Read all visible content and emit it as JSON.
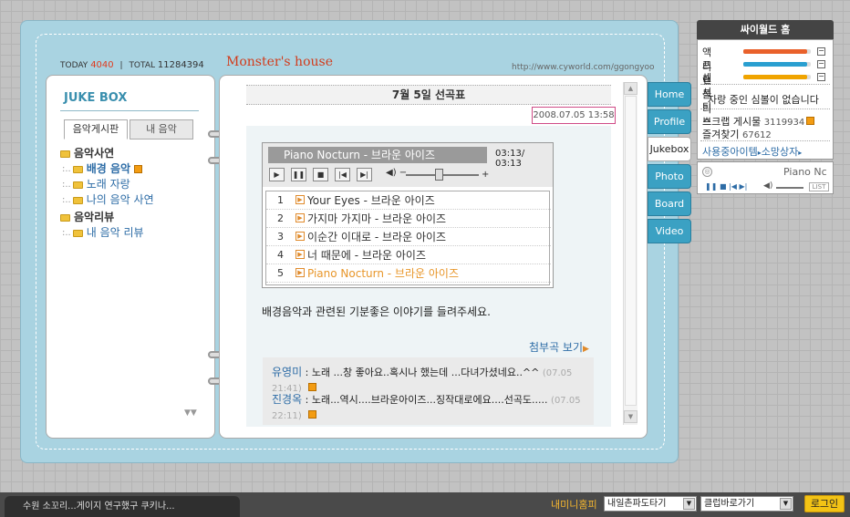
{
  "header": {
    "today_label": "TODAY",
    "today_count": "4040",
    "total_label": "TOTAL",
    "total_count": "11284394",
    "site_title": "Monster's house",
    "url": "http://www.cyworld.com/ggongyoo"
  },
  "left": {
    "title": "JUKE BOX",
    "tabs": [
      "음악게시판",
      "내 음악"
    ],
    "tree": {
      "group1": "음악사연",
      "items1": [
        "배경 음악",
        "노래 자랑",
        "나의 음악 사연"
      ],
      "group2": "음악리뷰",
      "items2": [
        "내 음악 리뷰"
      ]
    }
  },
  "post": {
    "title": "7월 5일 선곡표",
    "date": "2008.07.05 13:58",
    "description": "배경음악과 관련된 기분좋은 이야기를 들려주세요.",
    "attach_link": "첨부곡 보기"
  },
  "player": {
    "now_playing": "Piano Nocturn - 브라운 아이즈",
    "time": "03:13/ 03:13",
    "buttons": [
      "play",
      "pause",
      "stop",
      "prev",
      "next"
    ],
    "volume": 0.45,
    "tracks": [
      {
        "num": "1",
        "title": "Your Eyes - 브라운 아이즈"
      },
      {
        "num": "2",
        "title": "가지마 가지마 - 브라운 아이즈"
      },
      {
        "num": "3",
        "title": "이순간 이대로 - 브라운 아이즈"
      },
      {
        "num": "4",
        "title": "너 때문에 - 브라운 아이즈"
      },
      {
        "num": "5",
        "title": "Piano Nocturn - 브라운 아이즈"
      }
    ]
  },
  "comments": [
    {
      "author": "유영미",
      "text": " : 노래 ...창 좋아요..혹시나 했는데 ...다녀가셨네요..^^",
      "time": "(07.05 21:41)"
    },
    {
      "author": "진경옥",
      "text": " : 노래...역시....브라운아이즈...징작대로에요....선곡도.....",
      "time": "(07.05 22:11)"
    }
  ],
  "side_tabs": [
    "Home",
    "Profile",
    "Jukebox",
    "Photo",
    "Board",
    "Video"
  ],
  "widget": {
    "title": "싸이월드 홈",
    "meters": [
      {
        "label": "액티브",
        "color": "#e9612b",
        "fill": 0.95
      },
      {
        "label": "프랜들리",
        "color": "#2a9fd0",
        "fill": 0.95
      },
      {
        "label": "센서티브",
        "color": "#f0a400",
        "fill": 0.95
      }
    ],
    "no_symbol": "자랑 중인 심볼이 없습니다",
    "scrap_label": "스크랩 게시물",
    "scrap_count": "3119934",
    "fav_label": "즐겨찾기",
    "fav_count": "67612",
    "items_link": "사용중아이템",
    "shop_link": "소망상자",
    "mini_track": "Piano Nc",
    "list_btn": "LIST"
  },
  "bottom": {
    "notice": "수원 소꼬리...게이지 연구했구 쿠키나...",
    "minihompy": "내미니홈피",
    "select1": "내일촌파도타기",
    "select2": "클럽바로가기",
    "login": "로그인"
  }
}
